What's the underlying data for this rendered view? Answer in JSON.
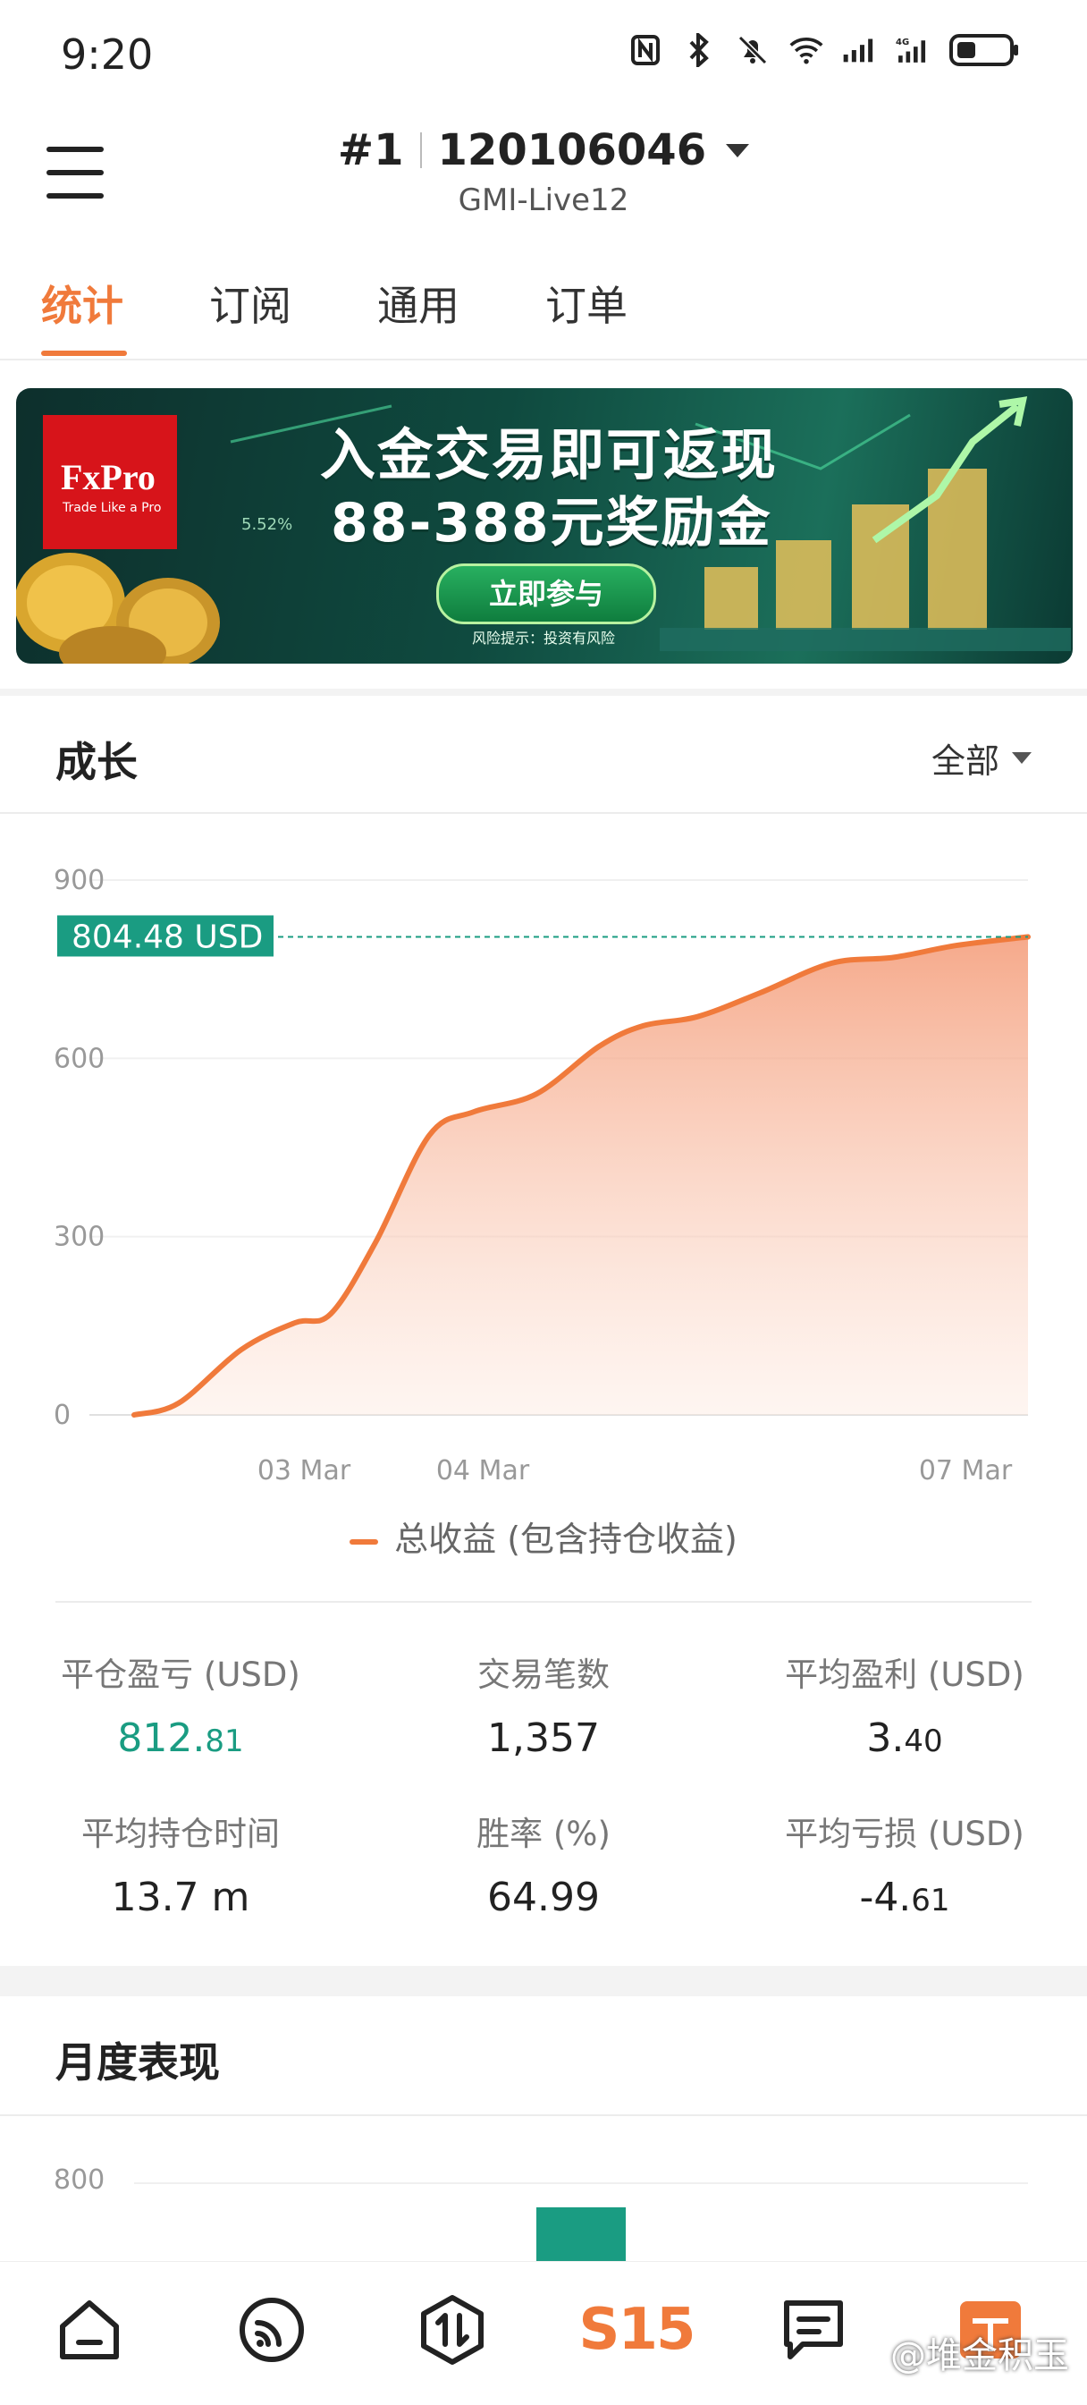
{
  "status_bar": {
    "time": "9:20"
  },
  "header": {
    "rank": "#1",
    "account": "120106046",
    "server": "GMI-Live12"
  },
  "tabs": [
    {
      "label": "统计",
      "active": true
    },
    {
      "label": "订阅"
    },
    {
      "label": "通用"
    },
    {
      "label": "订单"
    }
  ],
  "banner": {
    "logo_name": "FxPro",
    "logo_tagline": "Trade Like a Pro",
    "line1": "入金交易即可返现",
    "line2": "88-388元奖励金",
    "cta": "立即参与",
    "risk": "风险提示：投资有风险",
    "pct": "5.52%"
  },
  "growth": {
    "title": "成长",
    "filter": "全部",
    "current_label": "804.48 USD",
    "legend": "总收益 (包含持仓收益)"
  },
  "chart_data": {
    "type": "area",
    "y_ticks": [
      "900",
      "600",
      "300",
      "0"
    ],
    "ylim": [
      0,
      900
    ],
    "x_tick_labels": [
      {
        "label": "03 Mar",
        "x": 0.19
      },
      {
        "label": "04 Mar",
        "x": 0.39
      },
      {
        "label": "07 Mar",
        "x": 0.93
      }
    ],
    "series": [
      {
        "name": "总收益 (包含持仓收益)",
        "color": "#f07a3b",
        "x": [
          0.0,
          0.05,
          0.12,
          0.18,
          0.22,
          0.27,
          0.33,
          0.38,
          0.45,
          0.52,
          0.57,
          0.63,
          0.7,
          0.78,
          0.85,
          0.92,
          1.0
        ],
        "values": [
          0,
          20,
          110,
          155,
          170,
          290,
          470,
          510,
          540,
          620,
          655,
          670,
          710,
          760,
          770,
          790,
          804.48
        ]
      }
    ],
    "current_value": 804.48
  },
  "stats": [
    {
      "label": "平仓盈亏 (USD)",
      "int": "812.",
      "dec": "81",
      "color": "green"
    },
    {
      "label": "交易笔数",
      "int": "1,357",
      "dec": ""
    },
    {
      "label": "平均盈利 (USD)",
      "int": "3.",
      "dec": "40"
    },
    {
      "label": "平均持仓时间",
      "int": "13.7 m",
      "dec": ""
    },
    {
      "label": "胜率 (%)",
      "int": "64.99",
      "dec": ""
    },
    {
      "label": "平均亏损 (USD)",
      "int": "-4.",
      "dec": "61"
    }
  ],
  "monthly": {
    "title": "月度表现",
    "y_tick": "800"
  },
  "bottom_nav": {
    "items": [
      "home-icon",
      "feed-icon",
      "trade-icon",
      "s15-logo",
      "chat-icon",
      "gift-icon"
    ],
    "s15": "S15",
    "watermark": "@堆金积玉"
  }
}
